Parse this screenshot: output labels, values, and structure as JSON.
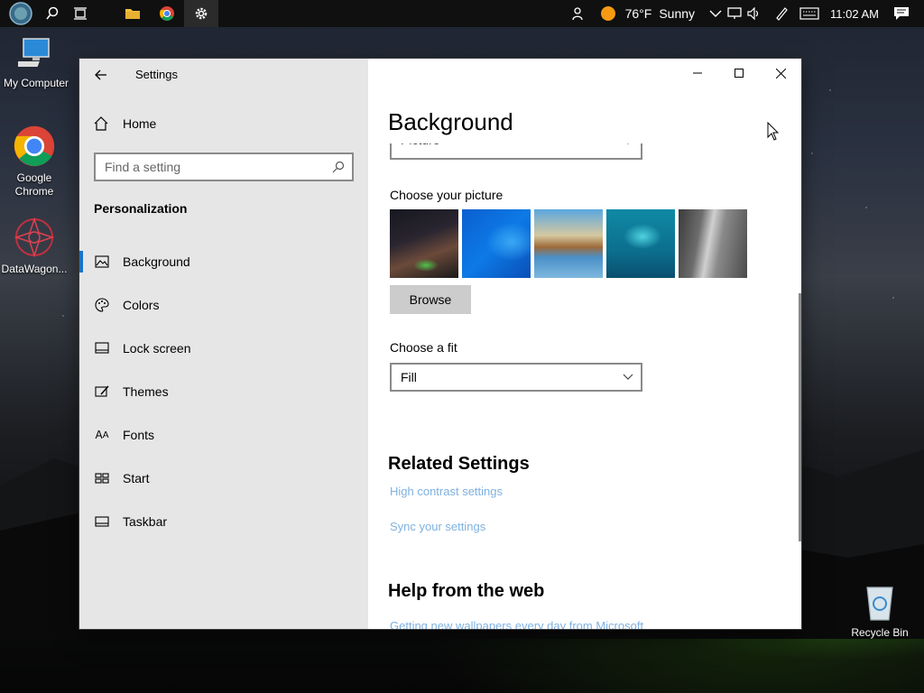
{
  "taskbar": {
    "weather_temp": "76°F",
    "weather_text": "Sunny",
    "time": "11:02 AM"
  },
  "desktop_icons": [
    {
      "label": "My Computer"
    },
    {
      "label": "Google Chrome"
    },
    {
      "label": "DataWagon..."
    },
    {
      "label": "Recycle Bin"
    }
  ],
  "window": {
    "app_title": "Settings",
    "sidebar": {
      "home_label": "Home",
      "search_placeholder": "Find a setting",
      "section_title": "Personalization",
      "items": [
        {
          "label": "Background",
          "icon": "picture-icon",
          "selected": true
        },
        {
          "label": "Colors",
          "icon": "palette-icon"
        },
        {
          "label": "Lock screen",
          "icon": "lock-screen-icon"
        },
        {
          "label": "Themes",
          "icon": "themes-icon"
        },
        {
          "label": "Fonts",
          "icon": "fonts-icon"
        },
        {
          "label": "Start",
          "icon": "start-icon"
        },
        {
          "label": "Taskbar",
          "icon": "taskbar-icon"
        }
      ]
    },
    "content": {
      "page_title": "Background",
      "background_dropdown_value": "Picture",
      "choose_picture_label": "Choose your picture",
      "browse_label": "Browse",
      "choose_fit_label": "Choose a fit",
      "fit_value": "Fill",
      "related_settings_title": "Related Settings",
      "related_links": [
        "High contrast settings",
        "Sync your settings"
      ],
      "help_title": "Help from the web",
      "help_links": [
        "Getting new wallpapers every day from Microsoft"
      ]
    }
  },
  "colors": {
    "accent": "#1a73c8",
    "link": "#7fb1e0",
    "sidebar_bg": "#e6e6e6"
  }
}
